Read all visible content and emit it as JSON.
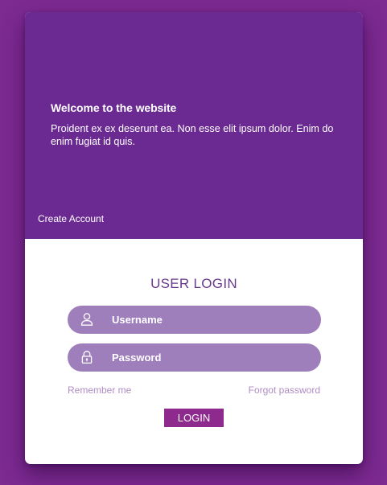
{
  "hero": {
    "title": "Welcome to the website",
    "text": "Proident ex ex deserunt ea. Non esse elit ipsum dolor. Enim do enim fugiat id quis.",
    "create_account": "Create Account"
  },
  "login": {
    "title": "USER LOGIN",
    "username_placeholder": "Username",
    "password_placeholder": "Password",
    "remember_me": "Remember me",
    "forgot_password": "Forgot password",
    "button_label": "LOGIN",
    "username_icon": "user-icon",
    "password_icon": "lock-icon"
  },
  "colors": {
    "background": "#7d2a91",
    "hero": "#6a2a92",
    "input": "#9e7fbc",
    "button": "#8e2a8e",
    "link": "#b08cc4"
  }
}
